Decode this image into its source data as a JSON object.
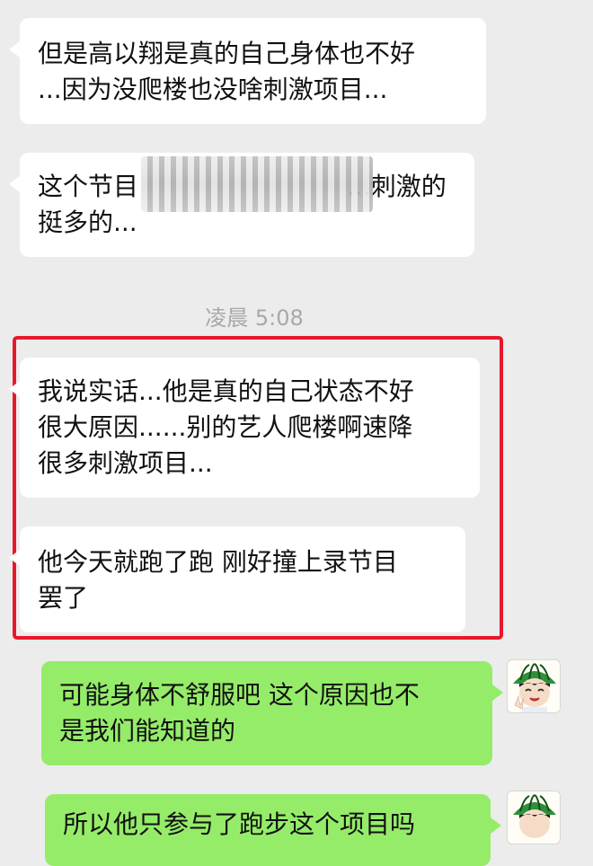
{
  "timestamp": "凌晨 5:08",
  "messages": [
    {
      "side": "in",
      "lines": [
        "但是高以翔是真的自己身体也不好",
        "...因为没爬楼也没啥刺激项目..."
      ]
    },
    {
      "side": "in",
      "lines": [
        "这个节目",
        "...刺激的",
        "挺多的..."
      ]
    },
    {
      "side": "in",
      "lines": [
        "我说实话...他是真的自己状态不好",
        "很大原因......别的艺人爬楼啊速降",
        "很多刺激项目..."
      ]
    },
    {
      "side": "in",
      "lines": [
        "他今天就跑了跑 刚好撞上录节目",
        "罢了"
      ]
    },
    {
      "side": "out",
      "lines": [
        "可能身体不舒服吧 这个原因也不",
        "是我们能知道的"
      ]
    },
    {
      "side": "out",
      "lines": [
        "所以他只参与了跑步这个项目吗"
      ]
    }
  ],
  "avatar": {
    "icon": "cartoon-boy-watermelon-hat-icon"
  },
  "colors": {
    "background": "#ececec",
    "incoming_bubble": "#ffffff",
    "outgoing_bubble": "#95ec69",
    "highlight_border": "#e8182b",
    "timestamp_text": "#a8a8a8"
  }
}
